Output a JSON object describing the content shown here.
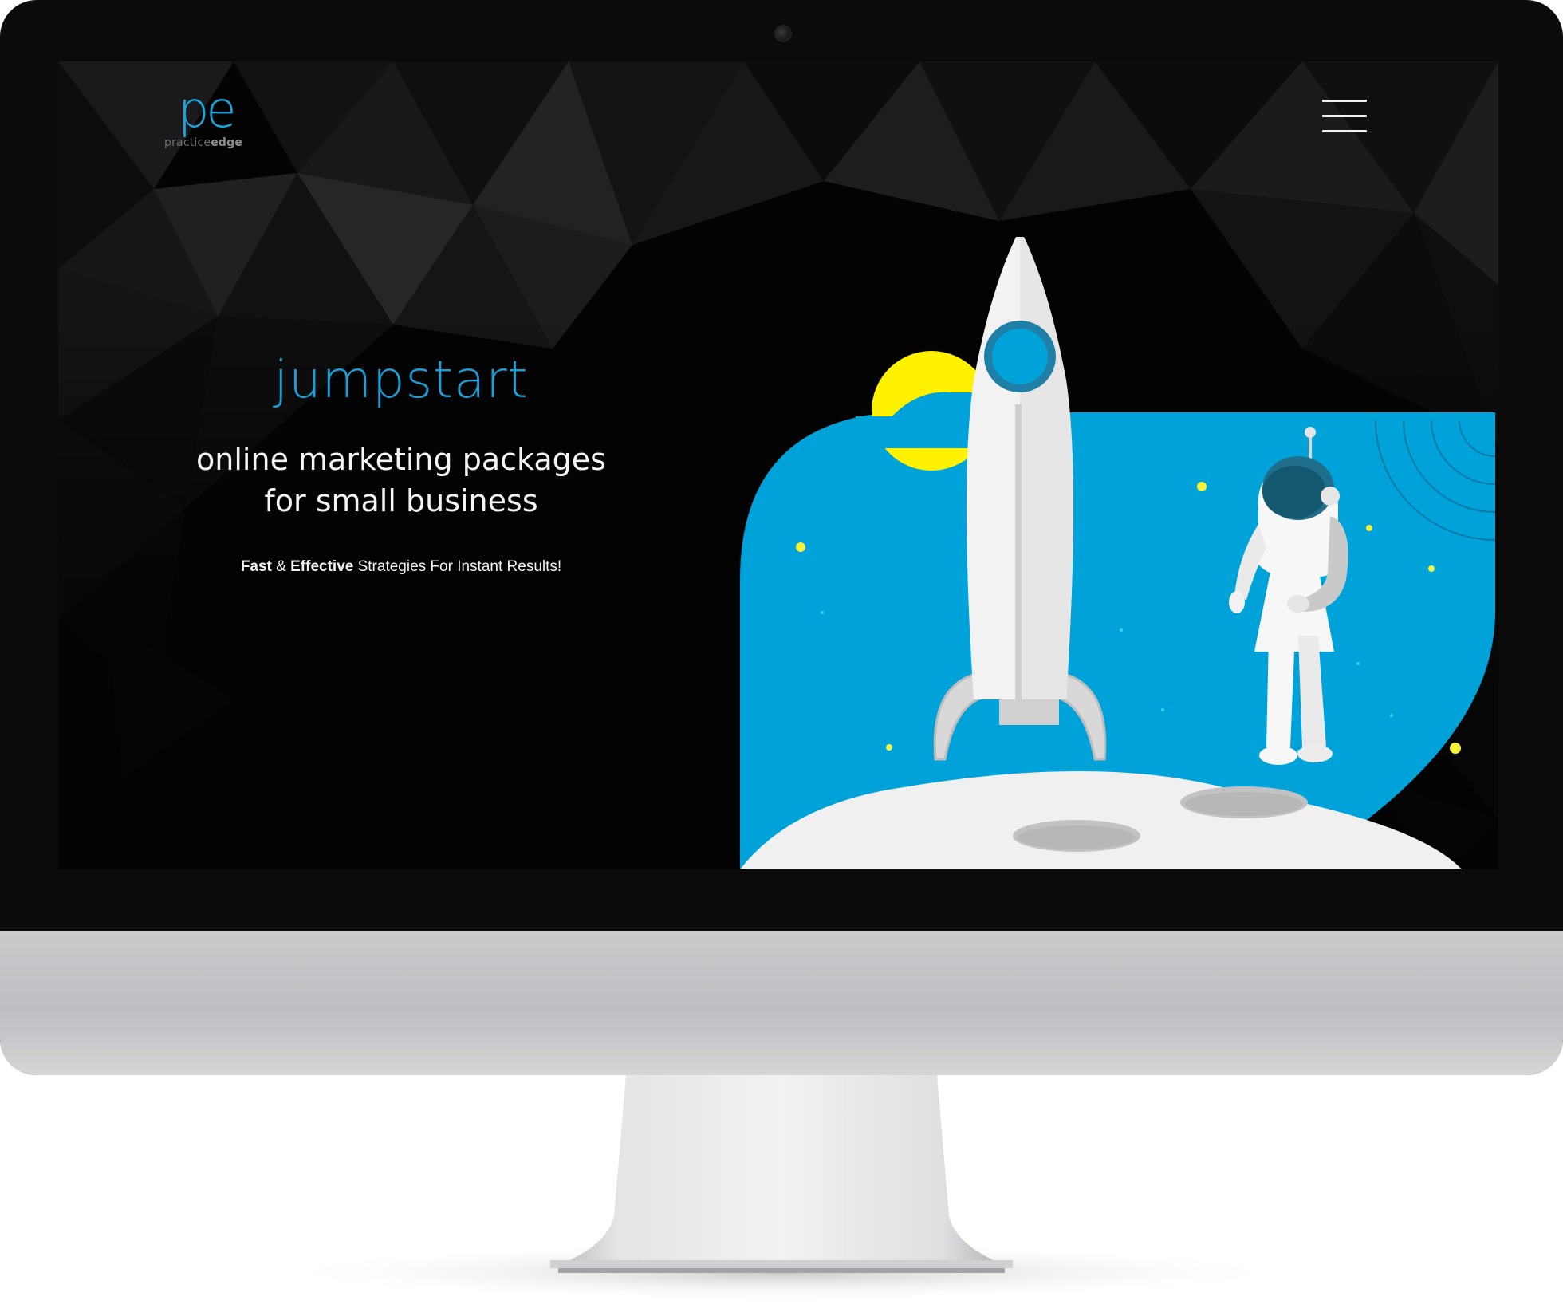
{
  "brand": {
    "logo_mark": "pe",
    "logo_text_light": "practice",
    "logo_text_bold": "edge"
  },
  "nav": {
    "menu_icon": "hamburger-menu-icon"
  },
  "hero": {
    "title": "jumpstart",
    "subtitle_line1": "online marketing packages",
    "subtitle_line2": "for small business",
    "tagline_bold1": "Fast",
    "tagline_amp": " & ",
    "tagline_bold2": "Effective",
    "tagline_rest": " Strategies For Instant Results!"
  },
  "illustration": {
    "subject": "rocket-and-astronaut-on-moon"
  },
  "colors": {
    "accent_blue": "#1a9fd8",
    "sky_blue": "#00a2da",
    "sun_yellow": "#fff200",
    "moon_gray": "#f0f0f0",
    "background": "#050505"
  }
}
